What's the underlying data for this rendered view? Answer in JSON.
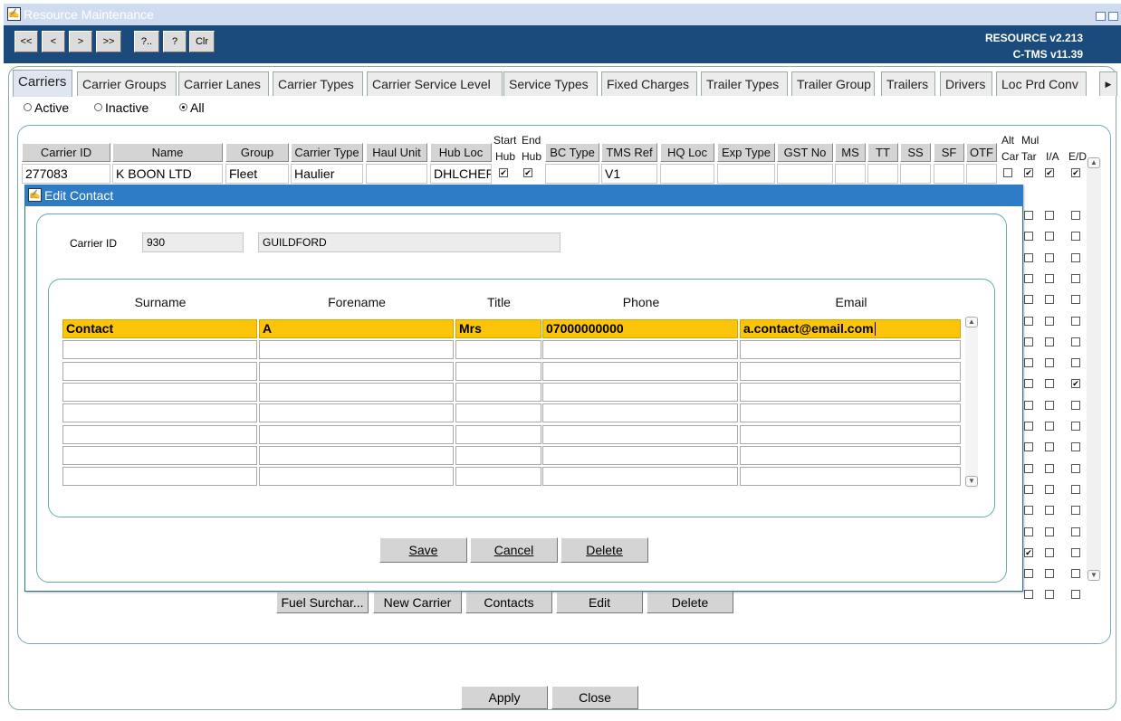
{
  "window": {
    "title": "Resource Maintenance",
    "icon": "app-logo-icon"
  },
  "toolbar": {
    "buttons": [
      "<<",
      "<",
      ">",
      ">>",
      "?..",
      "?",
      "Clr"
    ],
    "version_line1": "RESOURCE v2.213",
    "version_line2": "C-TMS v11.39"
  },
  "tabs": [
    "Carriers",
    "Carrier Groups",
    "Carrier Lanes",
    "Carrier Types",
    "Carrier Service Level",
    "Service Types",
    "Fixed Charges",
    "Trailer Types",
    "Trailer Group",
    "Trailers",
    "Drivers",
    "Loc Prd Conv"
  ],
  "filter": {
    "options": [
      "Active",
      "Inactive",
      "All"
    ],
    "selected": "All"
  },
  "grid": {
    "headers": [
      "Carrier ID",
      "Name",
      "Group",
      "Carrier Type",
      "Haul Unit",
      "Hub Loc",
      "BC Type",
      "TMS Ref",
      "HQ Loc",
      "Exp Type",
      "GST No",
      "MS",
      "TT",
      "SS",
      "SF",
      "OTF"
    ],
    "stacked_headers": {
      "start_hub_top": "Start",
      "start_hub_bottom": "Hub",
      "end_hub_top": "End",
      "end_hub_bottom": "Hub",
      "alt_car_top": "Alt",
      "alt_car_bottom": "Car",
      "mul_tar_top": "Mul",
      "mul_tar_bottom": "Tar",
      "ia": "I/A",
      "ed": "E/D"
    },
    "first_row": {
      "carrier_id": "277083",
      "name": "K BOON  LTD",
      "group": "Fleet",
      "carrier_type": "Haulier",
      "haul_unit": "",
      "hub_loc": "DHLCHER",
      "start_hub": true,
      "end_hub": true,
      "bc_type": "",
      "tms_ref": "V1",
      "alt_car": false,
      "mul_tar": true,
      "ia": true,
      "ed": true
    },
    "right_checkboxes": [
      [
        false,
        false,
        false
      ],
      [
        false,
        false,
        false
      ],
      [
        false,
        false,
        false
      ],
      [
        false,
        false,
        false
      ],
      [
        false,
        false,
        false
      ],
      [
        false,
        false,
        false
      ],
      [
        false,
        false,
        false
      ],
      [
        false,
        false,
        false
      ],
      [
        false,
        false,
        true
      ],
      [
        false,
        false,
        false
      ],
      [
        false,
        false,
        false
      ],
      [
        false,
        false,
        false
      ],
      [
        false,
        false,
        false
      ],
      [
        false,
        false,
        false
      ],
      [
        false,
        false,
        false
      ],
      [
        false,
        false,
        false
      ],
      [
        true,
        false,
        false
      ],
      [
        false,
        false,
        false
      ],
      [
        false,
        false,
        false
      ]
    ],
    "action_buttons": [
      "Fuel Surchar...",
      "New Carrier",
      "Contacts",
      "Edit",
      "Delete"
    ]
  },
  "dialog": {
    "title": "Edit Contact",
    "carrier_id_label": "Carrier ID",
    "carrier_id_value": "930",
    "carrier_name_value": "GUILDFORD",
    "columns": [
      "Surname",
      "Forename",
      "Title",
      "Phone",
      "Email"
    ],
    "rows": [
      [
        "Contact",
        "A",
        "Mrs",
        "07000000000",
        "a.contact@email.com"
      ],
      [
        "",
        "",
        "",
        "",
        ""
      ],
      [
        "",
        "",
        "",
        "",
        ""
      ],
      [
        "",
        "",
        "",
        "",
        ""
      ],
      [
        "",
        "",
        "",
        "",
        ""
      ],
      [
        "",
        "",
        "",
        "",
        ""
      ],
      [
        "",
        "",
        "",
        "",
        ""
      ],
      [
        "",
        "",
        "",
        "",
        ""
      ]
    ],
    "buttons": {
      "save": "Save",
      "cancel": "Cancel",
      "delete": "Delete"
    }
  },
  "footer": {
    "apply": "Apply",
    "close": "Close"
  },
  "colors": {
    "toolbar_bg": "#1b4a7c",
    "dialog_title_bg": "#2e7cc5",
    "selected_row": "#fcc50a"
  }
}
